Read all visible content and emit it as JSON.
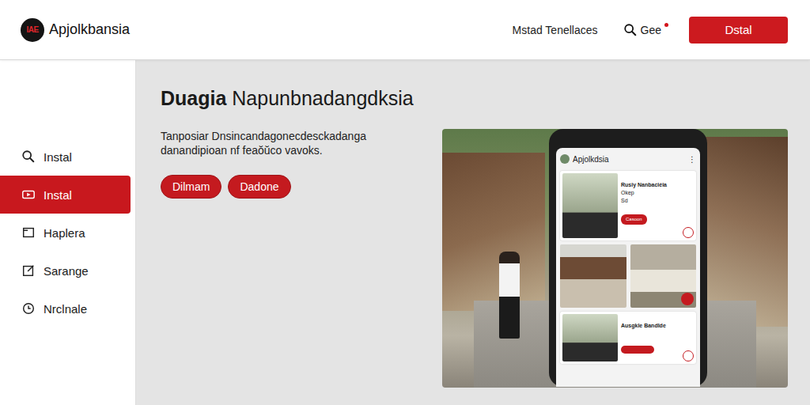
{
  "header": {
    "logo": "IAE",
    "brand": "Apjolkbansia",
    "link": "Mstad Tenellaces",
    "search_label": "Gee",
    "notification": true,
    "button": "Dstal"
  },
  "sidebar": {
    "items": [
      {
        "label": "Instal",
        "selected": false
      },
      {
        "label": "Instal",
        "selected": true
      },
      {
        "label": "Haplera",
        "selected": false
      },
      {
        "label": "Sarange",
        "selected": false
      },
      {
        "label": "Nrclnale",
        "selected": false
      }
    ]
  },
  "hero": {
    "title_bold": "Duagia",
    "title_rest": "Napunbnadangdksia",
    "description": "Tanposiar Dnsincandagonecdesckadanga danandipioan nf feaŏŭco vavoks.",
    "buttons": [
      "Dilmam",
      "Dadone"
    ]
  },
  "phone": {
    "app_title": "Apjolkdsia",
    "menu": "⋮",
    "card_top": {
      "title": "Rusiy Nanbaciéia",
      "lines": [
        "Okep",
        "Sd"
      ],
      "button": "Casoon"
    },
    "card_bottom": {
      "title": "Ausgkle Bandlde"
    }
  }
}
